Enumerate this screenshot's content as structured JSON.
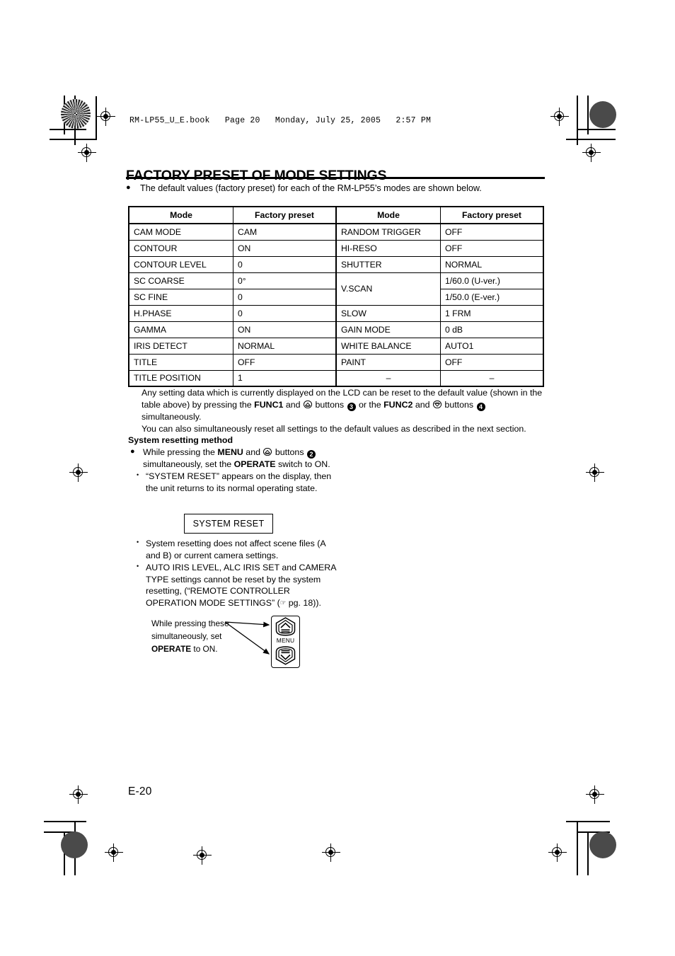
{
  "file_header": "RM-LP55_U_E.book   Page 20   Monday, July 25, 2005   2:57 PM",
  "title": "FACTORY PRESET OF MODE SETTINGS",
  "intro": {
    "bullet": "●",
    "text": "The default values (factory preset) for each of the RM-LP55’s modes are shown below."
  },
  "table": {
    "headers": [
      "Mode",
      "Factory preset",
      "Mode",
      "Factory preset"
    ],
    "rows": [
      {
        "mode_l": "CAM MODE",
        "preset_l": "CAM",
        "mode_r": "RANDOM TRIGGER",
        "preset_r": "OFF"
      },
      {
        "mode_l": "CONTOUR",
        "preset_l": "ON",
        "mode_r": "HI-RESO",
        "preset_r": "OFF"
      },
      {
        "mode_l": "CONTOUR LEVEL",
        "preset_l": "0",
        "mode_r": "SHUTTER",
        "preset_r": "NORMAL"
      },
      {
        "mode_l": "SC COARSE",
        "preset_l": "0°",
        "mode_r": "V.SCAN",
        "preset_r": "1/60.0 (U-ver.)"
      },
      {
        "mode_l": "SC FINE",
        "preset_l": "0",
        "mode_r": "",
        "preset_r": "1/50.0 (E-ver.)"
      },
      {
        "mode_l": "H.PHASE",
        "preset_l": "0",
        "mode_r": "SLOW",
        "preset_r": "1 FRM"
      },
      {
        "mode_l": "GAMMA",
        "preset_l": "ON",
        "mode_r": "GAIN MODE",
        "preset_r": "0 dB"
      },
      {
        "mode_l": "IRIS DETECT",
        "preset_l": "NORMAL",
        "mode_r": "WHITE BALANCE",
        "preset_r": "AUTO1"
      },
      {
        "mode_l": "TITLE",
        "preset_l": "OFF",
        "mode_r": "PAINT",
        "preset_r": "OFF"
      },
      {
        "mode_l": "TITLE POSITION",
        "preset_l": "1",
        "mode_r": "–",
        "preset_r": "–"
      }
    ]
  },
  "note": {
    "line1_a": "Any setting data which is currently displayed on the LCD can be reset to the default value (shown in the table above) by pressing the ",
    "func1": "FUNC1",
    "line1_b": " and ",
    "line1_c": " buttons ",
    "badge3": "3",
    "line1_d": " or the ",
    "func2": "FUNC2",
    "line1_e": " and ",
    "line1_f": " buttons ",
    "badge4": "4",
    "line1_g": " simultaneously.",
    "line2": "You can also simultaneously reset all settings to the default values as described in the next section."
  },
  "section": {
    "heading": "System resetting method",
    "item1": {
      "bullet": "●",
      "a": "While pressing the ",
      "menu": "MENU",
      "b": " and ",
      "c": " buttons ",
      "badge2": "2",
      "d": " simultaneously, set the ",
      "operate": "OPERATE",
      "e": " switch to ON."
    },
    "item2": {
      "bullet": "•",
      "text": "“SYSTEM RESET” appears on the display, then the unit returns to its normal operating state."
    },
    "lcd_display": "SYSTEM RESET",
    "item3": {
      "bullet": "•",
      "text": "System resetting does not affect scene files (A and B) or current camera settings."
    },
    "item4": {
      "bullet": "•",
      "a": "AUTO IRIS LEVEL, ALC IRIS SET and CAMERA TYPE settings cannot be reset by the system resetting, (“REMOTE CONTROLLER OPERATION MODE SETTINGS” (",
      "hand": "☞",
      "b": " pg. 18)).",
      "page_ref": "pg. 18"
    }
  },
  "diagram": {
    "caption_a": "While pressing these simultaneously, set ",
    "caption_operate": "OPERATE",
    "caption_b": " to ON.",
    "unit_label": "MENU",
    "button_up_name": "up-button",
    "button_down_name": "down-button"
  },
  "footer": {
    "page_number": "E-20"
  },
  "icons": {
    "up_button": "up-arrow-button-icon",
    "down_button": "down-arrow-button-icon",
    "pointing_hand": "pointing-hand-icon",
    "registration_mark": "registration-target-mark"
  },
  "colors": {
    "ink": "#000000",
    "paper": "#ffffff"
  }
}
